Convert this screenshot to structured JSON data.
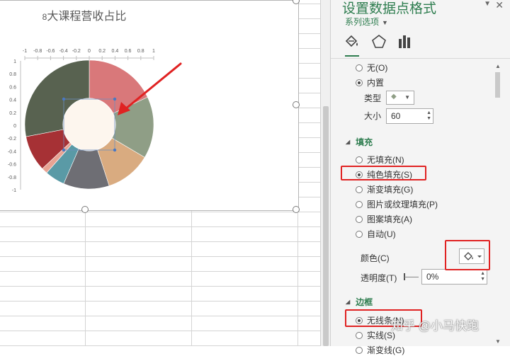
{
  "chart": {
    "title_prefix": "8",
    "title": "大课程营收占比",
    "x_ticks": [
      "-1",
      "-0.8",
      "-0.6",
      "-0.4",
      "-0.2",
      "0",
      "0.2",
      "0.4",
      "0.6",
      "0.8",
      "1"
    ],
    "y_ticks": [
      "1",
      "0.8",
      "0.6",
      "0.4",
      "0.2",
      "0",
      "-0.2",
      "-0.4",
      "-0.6",
      "-0.8",
      "-1"
    ],
    "slices": [
      {
        "color": "#d9787a",
        "fraction": 0.18
      },
      {
        "color": "#8f9e86",
        "fraction": 0.155
      },
      {
        "color": "#d9ab80",
        "fraction": 0.115
      },
      {
        "color": "#6e6e74",
        "fraction": 0.115
      },
      {
        "color": "#5a9aa6",
        "fraction": 0.05
      },
      {
        "color": "#e8a393",
        "fraction": 0.015
      },
      {
        "color": "#a63135",
        "fraction": 0.09
      },
      {
        "color": "#586250",
        "fraction": 0.28
      }
    ],
    "center_color": "#fdf6ee",
    "arrow_color": "#e02222"
  },
  "pane": {
    "title": "设置数据点格式",
    "series_options": "系列选项",
    "marker_none": "无(O)",
    "marker_builtin": "内置",
    "type_label": "类型",
    "size_label": "大小",
    "size_value": "60",
    "fill_section": "填充",
    "fill_options": [
      "无填充(N)",
      "纯色填充(S)",
      "渐变填充(G)",
      "图片或纹理填充(P)",
      "图案填充(A)",
      "自动(U)"
    ],
    "fill_selected": 1,
    "color_label": "颜色(C)",
    "transparency_label": "透明度(T)",
    "transparency_value": "0%",
    "border_section": "边框",
    "border_options": [
      "无线条(N)",
      "实线(S)",
      "渐变线(G)"
    ],
    "border_selected": 0,
    "accent": "#2e7d4f"
  },
  "watermark": "知乎 @小马快跑"
}
